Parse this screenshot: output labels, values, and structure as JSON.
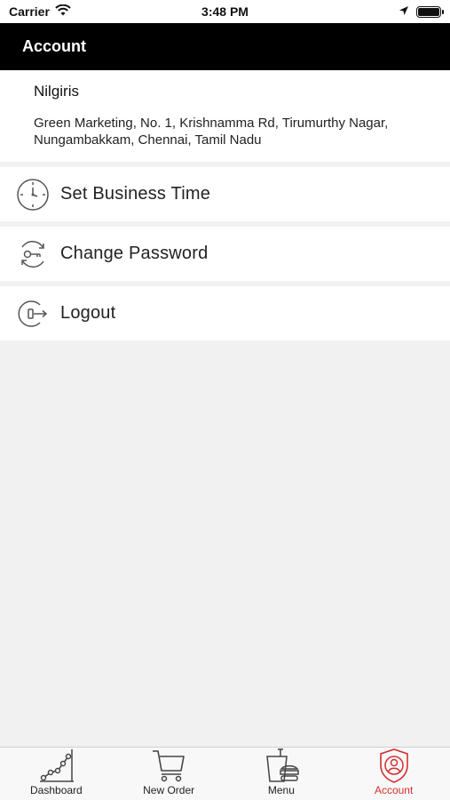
{
  "status_bar": {
    "carrier": "Carrier",
    "time": "3:48 PM"
  },
  "header": {
    "title": "Account"
  },
  "business": {
    "name": "Nilgiris",
    "address_line1": "Green Marketing, No. 1, Krishnamma Rd, Tirumurthy Nagar,",
    "address_line2": "Nungambakkam, Chennai, Tamil Nadu"
  },
  "menu": {
    "items": [
      {
        "label": "Set Business Time",
        "icon": "clock-icon"
      },
      {
        "label": "Change Password",
        "icon": "key-refresh-icon"
      },
      {
        "label": "Logout",
        "icon": "logout-icon"
      }
    ]
  },
  "tab_bar": {
    "tabs": [
      {
        "label": "Dashboard",
        "icon": "chart-line-icon"
      },
      {
        "label": "New Order",
        "icon": "cart-icon"
      },
      {
        "label": "Menu",
        "icon": "food-icon"
      },
      {
        "label": "Account",
        "icon": "account-shield-icon"
      }
    ],
    "active_index": 3,
    "active_color": "#d32f2f"
  }
}
